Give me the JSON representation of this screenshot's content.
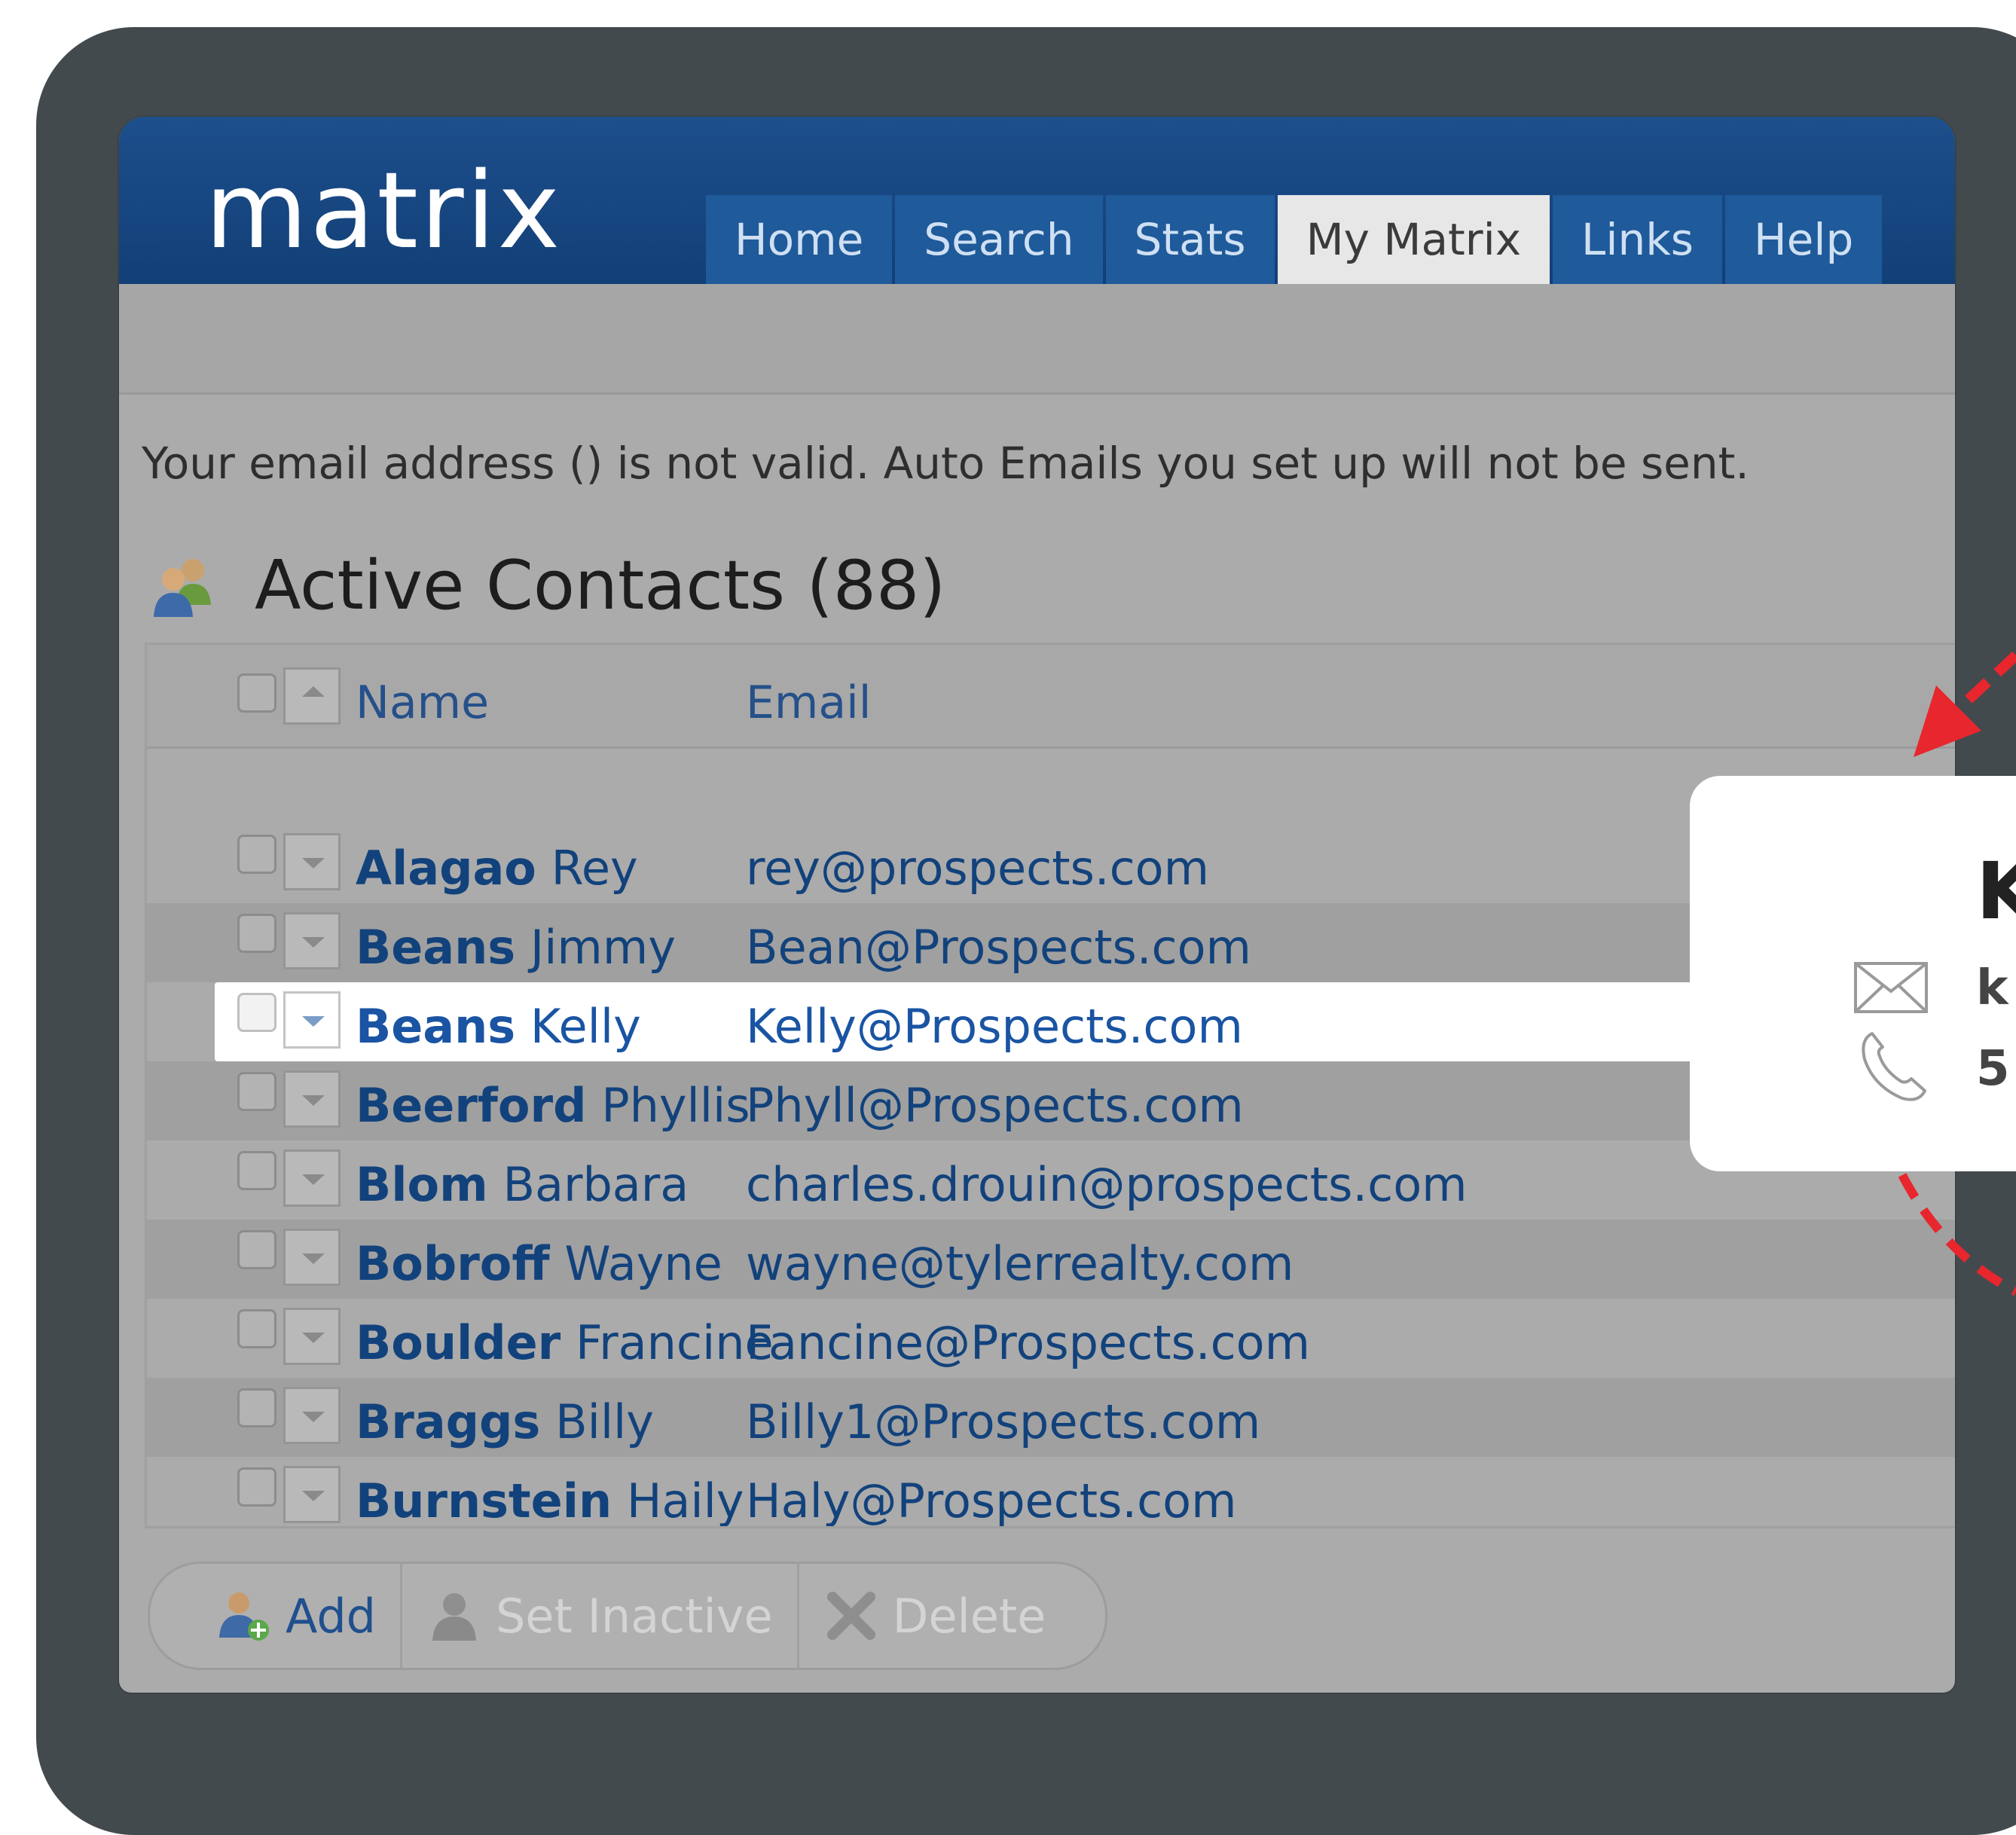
{
  "app": {
    "logo": "matrix",
    "tabs": [
      {
        "label": "Home",
        "active": false
      },
      {
        "label": "Search",
        "active": false
      },
      {
        "label": "Stats",
        "active": false
      },
      {
        "label": "My Matrix",
        "active": true
      },
      {
        "label": "Links",
        "active": false
      },
      {
        "label": "Help",
        "active": false
      }
    ]
  },
  "warning": "Your email address () is not valid. Auto Emails you set up will not be sent.",
  "contacts": {
    "title": "Active Contacts (88)",
    "columns": {
      "name": "Name",
      "email": "Email"
    },
    "rows": [
      {
        "last": "Alagao",
        "first": "Rey",
        "email": "rey@prospects.com"
      },
      {
        "last": "Beans",
        "first": "Jimmy",
        "email": "Bean@Prospects.com"
      },
      {
        "last": "Beans",
        "first": "Kelly",
        "email": "Kelly@Prospects.com"
      },
      {
        "last": "Beerford",
        "first": "Phyllis",
        "email": "Phyll@Prospects.com"
      },
      {
        "last": "Blom",
        "first": "Barbara",
        "email": "charles.drouin@prospects.com"
      },
      {
        "last": "Bobroff",
        "first": "Wayne",
        "email": "wayne@tylerrealty.com"
      },
      {
        "last": "Boulder",
        "first": "Francine",
        "email": "Fancine@Prospects.com"
      },
      {
        "last": "Braggs",
        "first": "Billy",
        "email": "Billy1@Prospects.com"
      },
      {
        "last": "Burnstein",
        "first": "Haily",
        "email": "Haly@Prospects.com"
      }
    ]
  },
  "toolbar": {
    "add": "Add",
    "set_inactive": "Set Inactive",
    "delete": "Delete"
  },
  "popup": {
    "name_initial": "K",
    "email_initial": "k",
    "phone_initial": "5"
  },
  "colors": {
    "header_blue": "#174985",
    "link_blue": "#12427c",
    "annotation_red": "#e8262d"
  }
}
